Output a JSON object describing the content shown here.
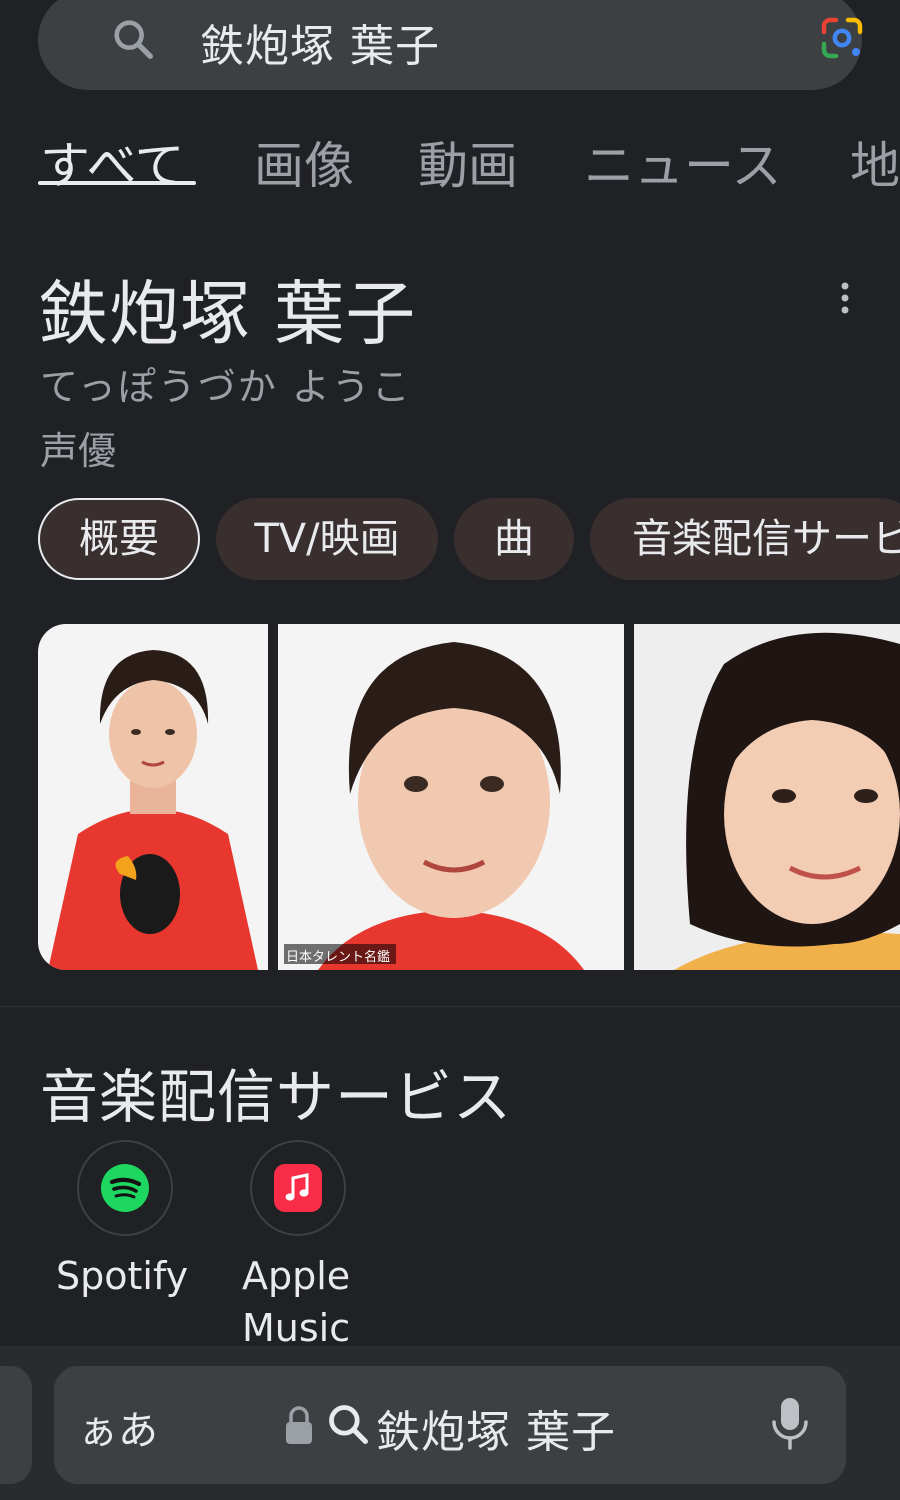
{
  "search": {
    "query": "鉄炮塚 葉子",
    "icons": {
      "search": "search-icon",
      "lens": "google-lens-icon"
    }
  },
  "tabs": [
    {
      "label": "すべて",
      "active": true
    },
    {
      "label": "画像"
    },
    {
      "label": "動画"
    },
    {
      "label": "ニュース"
    },
    {
      "label": "地"
    }
  ],
  "knowledge_panel": {
    "title": "鉄炮塚 葉子",
    "reading": "てっぽうづか ようこ",
    "type": "声優",
    "chips": [
      {
        "label": "概要",
        "selected": true
      },
      {
        "label": "TV/映画"
      },
      {
        "label": "曲"
      },
      {
        "label": "音楽配信サービ"
      }
    ],
    "images": [
      {
        "alt": "portrait-1",
        "caption": ""
      },
      {
        "alt": "portrait-2",
        "caption": "日本タレント名鑑"
      },
      {
        "alt": "portrait-3",
        "caption": ""
      }
    ]
  },
  "music_services": {
    "title": "音楽配信サービス",
    "items": [
      {
        "label": "Spotify",
        "icon": "spotify-icon",
        "color": "#1ed760"
      },
      {
        "label_line1": "Apple",
        "label_line2": "Music",
        "icon": "apple-music-icon",
        "color": "#fa2d48"
      }
    ]
  },
  "browser_bar": {
    "aa_label": "ぁあ",
    "address": "鉄炮塚 葉子"
  }
}
